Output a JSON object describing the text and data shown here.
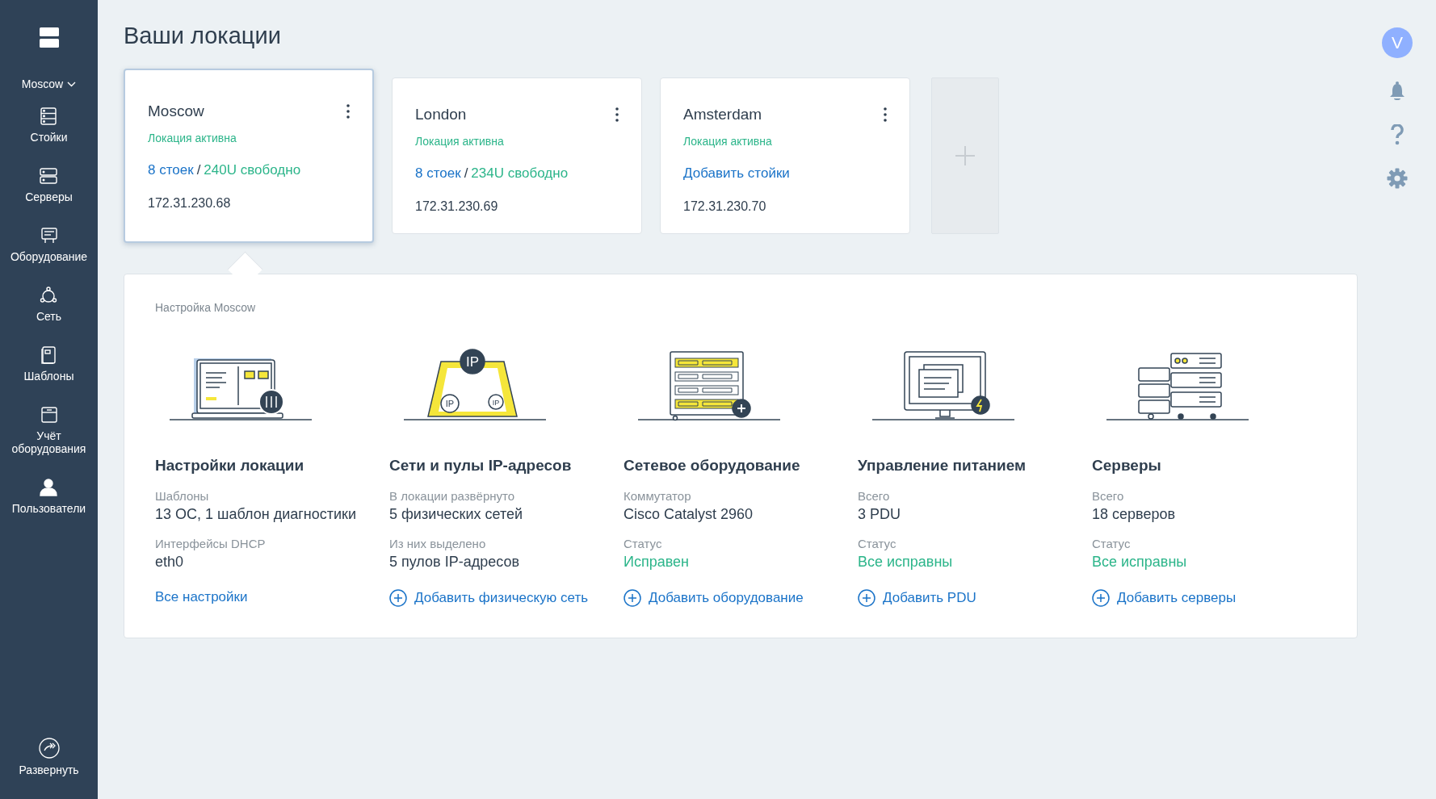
{
  "sidebar": {
    "location": "Moscow",
    "items": [
      {
        "label": "Стойки",
        "kind": "racks"
      },
      {
        "label": "Серверы",
        "kind": "servers"
      },
      {
        "label": "Оборудование",
        "kind": "equipment"
      },
      {
        "label": "Сеть",
        "kind": "network"
      },
      {
        "label": "Шаблоны",
        "kind": "templates"
      },
      {
        "label": "Учёт оборудования",
        "kind": "inventory"
      },
      {
        "label": "Пользователи",
        "kind": "users"
      }
    ],
    "expand": "Развернуть"
  },
  "title": "Ваши локации",
  "locations": [
    {
      "name": "Moscow",
      "status": "Локация активна",
      "racks": "8 стоек",
      "separator": "/",
      "free": "240U свободно",
      "ip": "172.31.230.68",
      "selected": true
    },
    {
      "name": "London",
      "status": "Локация активна",
      "racks": "8 стоек",
      "separator": "/",
      "free": "234U свободно",
      "ip": "172.31.230.69",
      "selected": false
    },
    {
      "name": "Amsterdam",
      "status": "Локация активна",
      "add_racks": "Добавить стойки",
      "ip": "172.31.230.70",
      "selected": false
    }
  ],
  "settings": {
    "title": "Настройка Moscow",
    "columns": [
      {
        "kind": "location",
        "title": "Настройки локации",
        "fields": [
          {
            "label": "Шаблоны",
            "value": "13 ОС, 1 шаблон диагностики",
            "kind": "text"
          },
          {
            "label": "Интерфейсы DHCP",
            "value": "eth0",
            "kind": "text"
          }
        ],
        "action": {
          "text": "Все настройки",
          "kind": "link"
        }
      },
      {
        "kind": "network",
        "badges": [
          "IP",
          "IP",
          "IP"
        ],
        "title": "Сети и пулы IP-адресов",
        "fields": [
          {
            "label": "В локации развёрнуто",
            "value": "5 физических сетей",
            "kind": "text"
          },
          {
            "label": "Из них выделено",
            "value": "5 пулов IP-адресов",
            "kind": "text"
          }
        ],
        "action": {
          "text": "Добавить физическую сеть",
          "kind": "add"
        }
      },
      {
        "kind": "equipment",
        "title": "Сетевое оборудование",
        "fields": [
          {
            "label": "Коммутатор",
            "value": "Cisco Catalyst 2960",
            "kind": "text"
          },
          {
            "label": "Статус",
            "value": "Исправен",
            "kind": "status"
          }
        ],
        "action": {
          "text": "Добавить оборудование",
          "kind": "add"
        }
      },
      {
        "kind": "power",
        "title": "Управление питанием",
        "fields": [
          {
            "label": "Всего",
            "value": "3 PDU",
            "kind": "text"
          },
          {
            "label": "Статус",
            "value": "Все исправны",
            "kind": "status"
          }
        ],
        "action": {
          "text": "Добавить PDU",
          "kind": "add"
        }
      },
      {
        "kind": "servers",
        "title": "Серверы",
        "fields": [
          {
            "label": "Всего",
            "value": "18 серверов",
            "kind": "text"
          },
          {
            "label": "Статус",
            "value": "Все исправны",
            "kind": "status"
          }
        ],
        "action": {
          "text": "Добавить серверы",
          "kind": "add"
        }
      }
    ]
  },
  "user": {
    "initial": "V"
  }
}
